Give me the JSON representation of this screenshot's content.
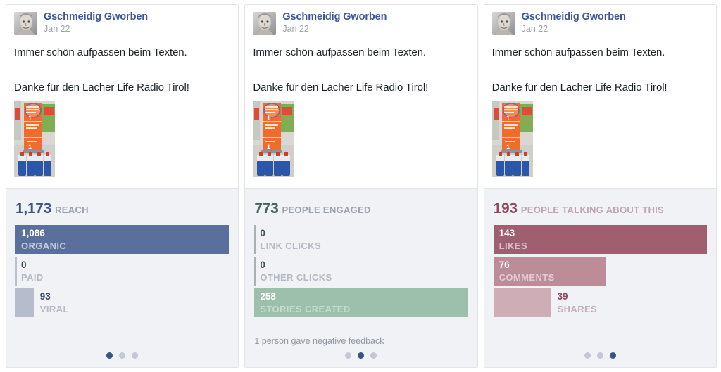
{
  "cards": [
    {
      "post": {
        "author": "Gschmeidig Gworben",
        "date": "Jan 22",
        "line1": "Immer schön aufpassen beim Texten.",
        "line2": "Danke für den Lacher Life Radio Tirol!",
        "avatar_alt": "profile-photo",
        "thumb_alt": "supermarket-shelf-photo"
      },
      "summary": {
        "value": "1,173",
        "label": "REACH",
        "value_color": "#3e5582",
        "label_color": "#9ba1ae"
      },
      "rows": [
        {
          "value": "1,086",
          "label": "ORGANIC",
          "pct": 100,
          "bar_color": "#5b6f9c",
          "value_color": "#ffffff",
          "label_color": "#c3cbdd",
          "text_inside": true
        },
        {
          "value": "0",
          "label": "PAID",
          "pct": 0,
          "bar_color": "#b9bfcc",
          "value_color": "#3e4a61",
          "label_color": "#b4b9c4",
          "text_inside": true
        },
        {
          "value": "93",
          "label": "VIRAL",
          "pct": 8.5,
          "bar_color": "#b6bccb",
          "value_color": "#3e4a61",
          "label_color": "#b4b9c4",
          "text_inside": false
        }
      ],
      "note": "",
      "dots": [
        true,
        false,
        false
      ]
    },
    {
      "post": {
        "author": "Gschmeidig Gworben",
        "date": "Jan 22",
        "line1": "Immer schön aufpassen beim Texten.",
        "line2": "Danke für den Lacher Life Radio Tirol!",
        "avatar_alt": "profile-photo",
        "thumb_alt": "supermarket-shelf-photo"
      },
      "summary": {
        "value": "773",
        "label": "PEOPLE ENGAGED",
        "value_color": "#46645b",
        "label_color": "#9ba1ae"
      },
      "rows": [
        {
          "value": "0",
          "label": "LINK CLICKS",
          "pct": 0,
          "bar_color": "#a9b1b0",
          "value_color": "#3f5149",
          "label_color": "#b4b9c4",
          "text_inside": true
        },
        {
          "value": "0",
          "label": "OTHER CLICKS",
          "pct": 0,
          "bar_color": "#a9b1b0",
          "value_color": "#3f5149",
          "label_color": "#b4b9c4",
          "text_inside": true
        },
        {
          "value": "258",
          "label": "STORIES CREATED",
          "pct": 100,
          "bar_color": "#9dc0ad",
          "value_color": "#ffffff",
          "label_color": "#c6dccf",
          "text_inside": true
        }
      ],
      "note": "1 person gave negative feedback",
      "dots": [
        false,
        true,
        false
      ]
    },
    {
      "post": {
        "author": "Gschmeidig Gworben",
        "date": "Jan 22",
        "line1": "Immer schön aufpassen beim Texten.",
        "line2": "Danke für den Lacher Life Radio Tirol!",
        "avatar_alt": "profile-photo",
        "thumb_alt": "supermarket-shelf-photo"
      },
      "summary": {
        "value": "193",
        "label": "PEOPLE TALKING ABOUT THIS",
        "value_color": "#8e4a5d",
        "label_color": "#bfa5ae"
      },
      "rows": [
        {
          "value": "143",
          "label": "LIKES",
          "pct": 100,
          "bar_color": "#a05f71",
          "value_color": "#ffffff",
          "label_color": "#d8bfc7",
          "text_inside": true
        },
        {
          "value": "76",
          "label": "COMMENTS",
          "pct": 53,
          "bar_color": "#bd8c99",
          "value_color": "#ffffff",
          "label_color": "#e2cbd2",
          "text_inside": true
        },
        {
          "value": "39",
          "label": "SHARES",
          "pct": 27,
          "bar_color": "#ceadb6",
          "value_color": "#8e4a5d",
          "label_color": "#c4aeb5",
          "text_inside": false
        }
      ],
      "note": "",
      "dots": [
        false,
        false,
        true
      ]
    }
  ],
  "chart_data": {
    "type": "bar",
    "title": "Facebook post insights cards",
    "charts": [
      {
        "title": "1,173 REACH",
        "categories": [
          "ORGANIC",
          "PAID",
          "VIRAL"
        ],
        "values": [
          1086,
          0,
          93
        ],
        "total": 1173,
        "color": "#5b6f9c"
      },
      {
        "title": "773 PEOPLE ENGAGED",
        "categories": [
          "LINK CLICKS",
          "OTHER CLICKS",
          "STORIES CREATED"
        ],
        "values": [
          0,
          0,
          258
        ],
        "total": 773,
        "color": "#9dc0ad"
      },
      {
        "title": "193 PEOPLE TALKING ABOUT THIS",
        "categories": [
          "LIKES",
          "COMMENTS",
          "SHARES"
        ],
        "values": [
          143,
          76,
          39
        ],
        "total": 193,
        "color": "#a05f71"
      }
    ],
    "xlabel": "",
    "ylabel": "",
    "grid": false,
    "legend": "none"
  }
}
